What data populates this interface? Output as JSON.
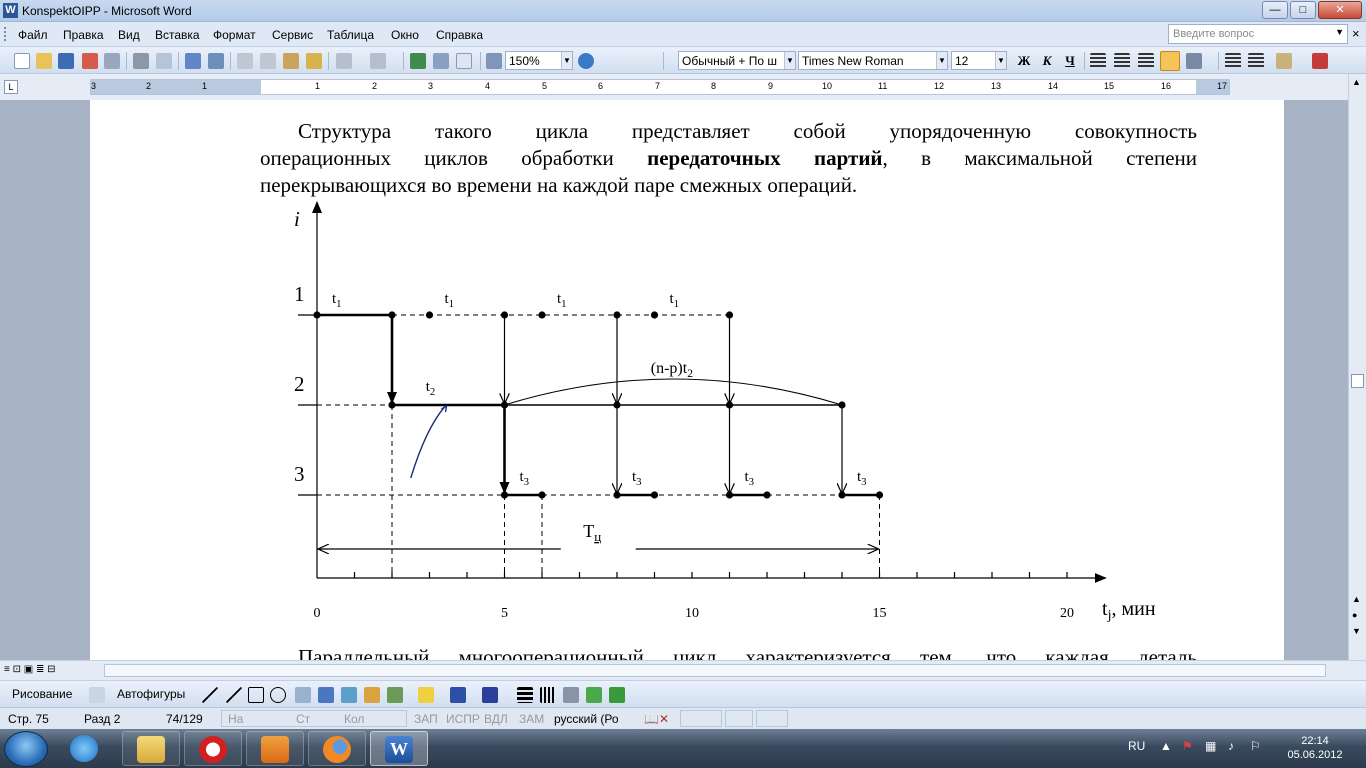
{
  "window": {
    "title": "KonspektOIPP - Microsoft Word",
    "app_icon_letter": "W",
    "controls": {
      "minimize": "—",
      "maximize": "□",
      "close": "✕"
    }
  },
  "menu": {
    "items": [
      "Файл",
      "Правка",
      "Вид",
      "Вставка",
      "Формат",
      "Сервис",
      "Таблица",
      "Окно",
      "Справка"
    ],
    "ask_placeholder": "Введите вопрос",
    "doc_close": "×"
  },
  "toolbar": {
    "zoom": "150%",
    "style": "Обычный + По ш",
    "font": "Times New Roman",
    "size": "12",
    "bold": "Ж",
    "italic": "К",
    "underline": "Ч"
  },
  "ruler": {
    "numbers": [
      "3",
      "2",
      "1",
      "1",
      "2",
      "3",
      "4",
      "5",
      "6",
      "7",
      "8",
      "9",
      "10",
      "11",
      "12",
      "13",
      "14",
      "15",
      "16",
      "17"
    ]
  },
  "document": {
    "para1": {
      "line1": "Структура такого цикла представляет собой упорядоченную совокупность",
      "line2_a": "операционных циклов обработки ",
      "line2_b": "передаточных партий",
      "line2_c": ", в максимальной степени",
      "line3": "перекрывающихся  во времени на каждой паре смежных операций."
    },
    "para2_line1": "Параллельный многооперационный цикл  характеризуется тем, что каждая деталь"
  },
  "chart_data": {
    "type": "diagram",
    "title": "",
    "ylabel": "i",
    "xlabel_main": "t",
    "xlabel_sub": "j",
    "xlabel_unit": ", мин",
    "x_ticks": [
      "0",
      "5",
      "10",
      "15",
      "20"
    ],
    "xlim": [
      0,
      20.5
    ],
    "y_levels": [
      {
        "label": "1",
        "level": 1
      },
      {
        "label": "2",
        "level": 2
      },
      {
        "label": "3",
        "level": 3
      }
    ],
    "op1_points": [
      0,
      2,
      3,
      5,
      6,
      8,
      9,
      11
    ],
    "op2_points": [
      2,
      5,
      8,
      11,
      14
    ],
    "op3_points": [
      5,
      6,
      8,
      9,
      11,
      12,
      14,
      15
    ],
    "labels": {
      "t1": "t",
      "t1_sub": "1",
      "t2": "t",
      "t2_sub": "2",
      "t3": "t",
      "t3_sub": "3",
      "np_prefix": "(n-p)t",
      "np_sub": "2",
      "tc": "Т",
      "tc_sub": "ц"
    },
    "cycle_span": [
      0,
      15
    ]
  },
  "scroll": {
    "view_icons": "≡ ⊡ ▣ ≣ ⊟"
  },
  "drawbar": {
    "drawing": "Рисование",
    "autoshapes": "Автофигуры"
  },
  "status": {
    "page": "Стр. 75",
    "section": "Разд  2",
    "pages": "74/129",
    "at": "На",
    "line": "Ст",
    "col": "Кол",
    "rec": "ЗАП",
    "trk": "ИСПР",
    "ext": "ВДЛ",
    "ovr": "ЗАМ",
    "lang": "русский (Ро"
  },
  "taskbar": {
    "lang": "RU",
    "time": "22:14",
    "date": "05.06.2012"
  },
  "colors": {
    "arrow_blue": "#1f2f7a",
    "word_blue": "#2b5797"
  }
}
